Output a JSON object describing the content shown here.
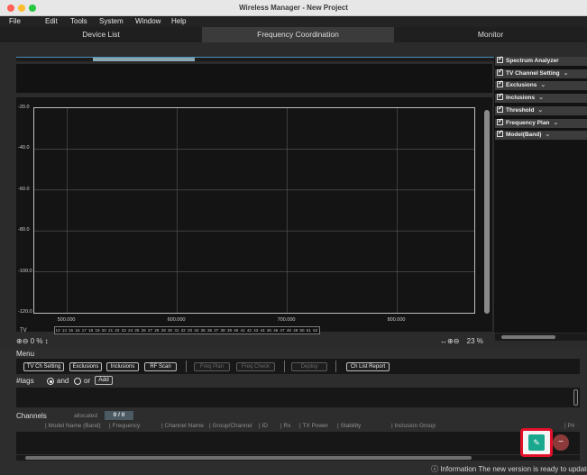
{
  "window": {
    "title": "Wireless Manager - New Project"
  },
  "menu": {
    "items": [
      "File",
      "Edit",
      "Tools",
      "System",
      "Window",
      "Help"
    ]
  },
  "tabs": [
    {
      "label": "Device List",
      "active": false
    },
    {
      "label": "Frequency Coordination",
      "active": true
    },
    {
      "label": "Monitor",
      "active": false
    }
  ],
  "chart_data": {
    "type": "line",
    "yticks": [
      "-20.0",
      "-40.0",
      "-60.0",
      "-80.0",
      "-100.0",
      "-120.0"
    ],
    "xticks": [
      "500.000",
      "600.000",
      "700.000",
      "800.000"
    ],
    "ylim": [
      -120,
      -20
    ],
    "xlim": [
      470,
      870
    ],
    "grid": true,
    "series": []
  },
  "tv": {
    "label": "TV",
    "channels": [
      "13",
      "14",
      "15",
      "16",
      "17",
      "18",
      "19",
      "20",
      "21",
      "22",
      "23",
      "24",
      "25",
      "26",
      "27",
      "28",
      "29",
      "30",
      "31",
      "32",
      "33",
      "34",
      "35",
      "36",
      "37",
      "38",
      "39",
      "40",
      "41",
      "42",
      "43",
      "44",
      "45",
      "46",
      "47",
      "48",
      "49",
      "50",
      "51",
      "52"
    ]
  },
  "zoom": {
    "left_value": "0 %",
    "right_value": "23 %"
  },
  "sidebar": {
    "items": [
      {
        "label": "Spectrum Analyzer",
        "chevron": false
      },
      {
        "label": "TV Channel Setting",
        "chevron": true
      },
      {
        "label": "Exclusions",
        "chevron": true
      },
      {
        "label": "Inclusions",
        "chevron": true
      },
      {
        "label": "Threshold",
        "chevron": true
      },
      {
        "label": "Frequency Plan",
        "chevron": true
      },
      {
        "label": "Model(Band)",
        "chevron": true
      }
    ]
  },
  "menu_section": {
    "label": "Menu",
    "buttons": [
      {
        "label": "TV Ch Setting",
        "enabled": true
      },
      {
        "label": "Exclusions",
        "enabled": true
      },
      {
        "label": "Inclusions",
        "enabled": true
      },
      {
        "label": "RF Scan",
        "enabled": true
      },
      {
        "label": "Freq Plan",
        "enabled": false
      },
      {
        "label": "Freq Check",
        "enabled": false
      },
      {
        "label": "Deploy",
        "enabled": false
      },
      {
        "label": "Ch List Report",
        "enabled": true
      }
    ]
  },
  "tags": {
    "label": "#tags",
    "and_label": "and",
    "or_label": "or",
    "add_label": "Add"
  },
  "channels": {
    "label": "Channels",
    "allocated_label": "allocated",
    "allocated_value": "0 / 0",
    "columns": [
      "Model Name (Band)",
      "Frequency",
      "Channel Name",
      "Group/Channel",
      "ID",
      "Rx",
      "TX Power",
      "Stability",
      "Inclusion Group",
      "Pri"
    ]
  },
  "status": {
    "info": "ⓘ Information The new version is ready to update."
  },
  "icons": {
    "zoom_in": "zoom-in-icon",
    "zoom_out": "zoom-out-icon",
    "resize": "vertical-resize-icon",
    "edit": "edit-icon",
    "remove": "remove-icon"
  },
  "colors": {
    "accent_green": "#19a88e",
    "remove_red": "#8d3a3a",
    "highlight": "#e3102a"
  }
}
